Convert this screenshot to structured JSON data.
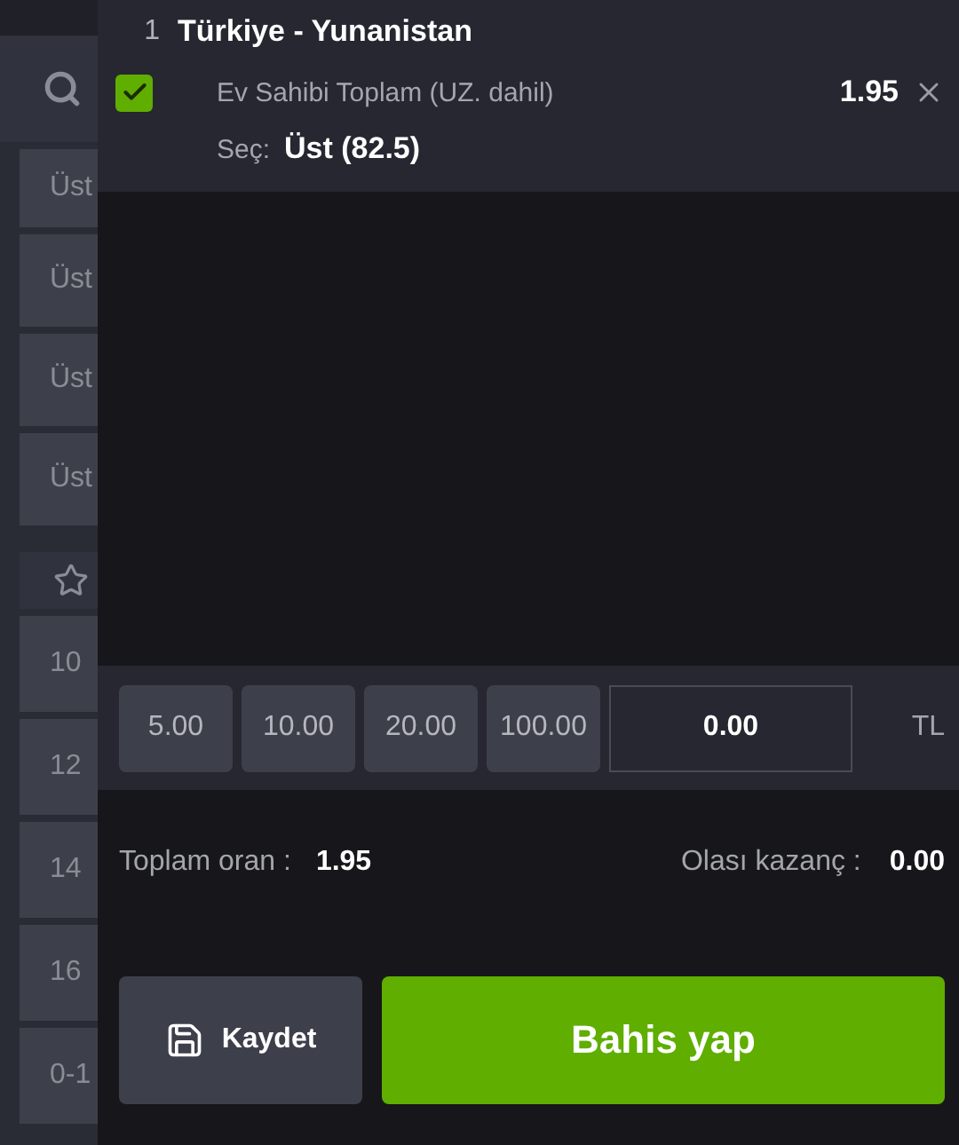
{
  "sidebar": {
    "rows_top": [
      {
        "label": "Üst"
      },
      {
        "label": "Üst"
      },
      {
        "label": "Üst"
      },
      {
        "label": "Üst"
      }
    ],
    "rows_bottom": [
      {
        "label": "10"
      },
      {
        "label": "12"
      },
      {
        "label": "14"
      },
      {
        "label": "16"
      },
      {
        "label": "0-1"
      }
    ]
  },
  "bet": {
    "number": "1",
    "match": "Türkiye - Yunanistan",
    "checked": true,
    "market": "Ev Sahibi Toplam (UZ. dahil)",
    "odds": "1.95",
    "pick_label": "Seç:",
    "pick": "Üst (82.5)"
  },
  "stakes": [
    "5.00",
    "10.00",
    "20.00",
    "100.00"
  ],
  "stake_input": {
    "value": "0.00"
  },
  "currency": "TL",
  "totals": {
    "odds_label": "Toplam oran :",
    "odds": "1.95",
    "win_label": "Olası kazanç :",
    "win": "0.00"
  },
  "buttons": {
    "save": "Kaydet",
    "place": "Bahis yap"
  }
}
